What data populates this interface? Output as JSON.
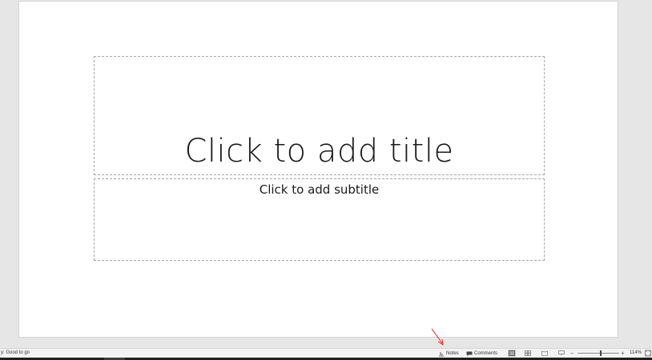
{
  "slide": {
    "title_placeholder": "Click to add title",
    "subtitle_placeholder": "Click to add subtitle"
  },
  "status_bar": {
    "accessibility_text": "y: Good to go",
    "notes_label": "Notes",
    "comments_label": "Comments",
    "zoom_minus": "–",
    "zoom_plus": "+",
    "zoom_level": "114%",
    "zoom_value": 114,
    "view_icons": [
      "normal-view-icon",
      "slide-sorter-icon",
      "reading-view-icon",
      "slide-show-icon"
    ],
    "active_view": "normal"
  },
  "annotation": {
    "arrow_color": "#e02020"
  }
}
